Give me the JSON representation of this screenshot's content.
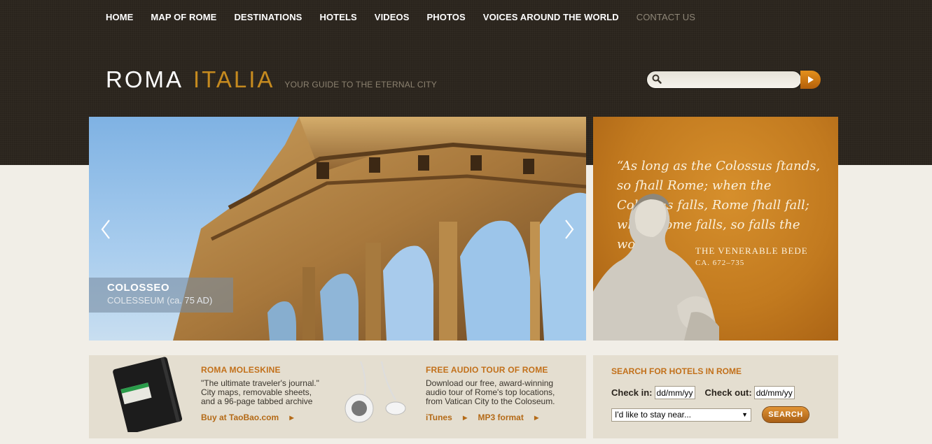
{
  "nav": {
    "items": [
      {
        "label": "HOME"
      },
      {
        "label": "MAP OF ROME"
      },
      {
        "label": "DESTINATIONS"
      },
      {
        "label": "HOTELS"
      },
      {
        "label": "VIDEOS"
      },
      {
        "label": "PHOTOS"
      },
      {
        "label": "VOICES AROUND THE WORLD"
      },
      {
        "label": "CONTACT US"
      }
    ]
  },
  "logo": {
    "roma": "ROMA",
    "italia": "ITALIA",
    "tagline": "YOUR GUIDE TO THE ETERNAL CITY"
  },
  "search": {
    "value": "",
    "placeholder": ""
  },
  "hero": {
    "caption_title": "COLOSSEO",
    "caption_sub": "COLESSEUM (ca. 75 AD)"
  },
  "quote": {
    "text": "“As long as the Colossus ſtands, so ſhall Rome; when the Colossus falls, Rome ſhall fall; when Rome falls, so falls the world.”",
    "author": "THE VENERABLE BEDE",
    "date": "CA. 672–735"
  },
  "promo": {
    "moleskine": {
      "title": "ROMA MOLESKINE",
      "body": "\"The ultimate traveler's journal.\" City maps, removable sheets, and a 96-page tabbed archive",
      "link": "Buy at TaoBao.com"
    },
    "audio": {
      "title": "FREE AUDIO TOUR OF ROME",
      "body": "Download our free, award-winning audio tour of Rome's top locations, from Vatican City to the Coloseum.",
      "link_itunes": "iTunes",
      "link_mp3": "MP3 format"
    }
  },
  "hotels": {
    "title": "SEARCH FOR HOTELS IN ROME",
    "checkin_label": "Check in:",
    "checkin_value": "dd/mm/yy",
    "checkout_label": "Check out:",
    "checkout_value": "dd/mm/yy",
    "near_select": "I'd like to stay near...",
    "search_button": "SEARCH"
  },
  "colors": {
    "header_bg": "#2a241d",
    "accent_orange": "#c2701a",
    "logo_gold": "#c58a1f",
    "page_bg": "#f1eee7"
  }
}
